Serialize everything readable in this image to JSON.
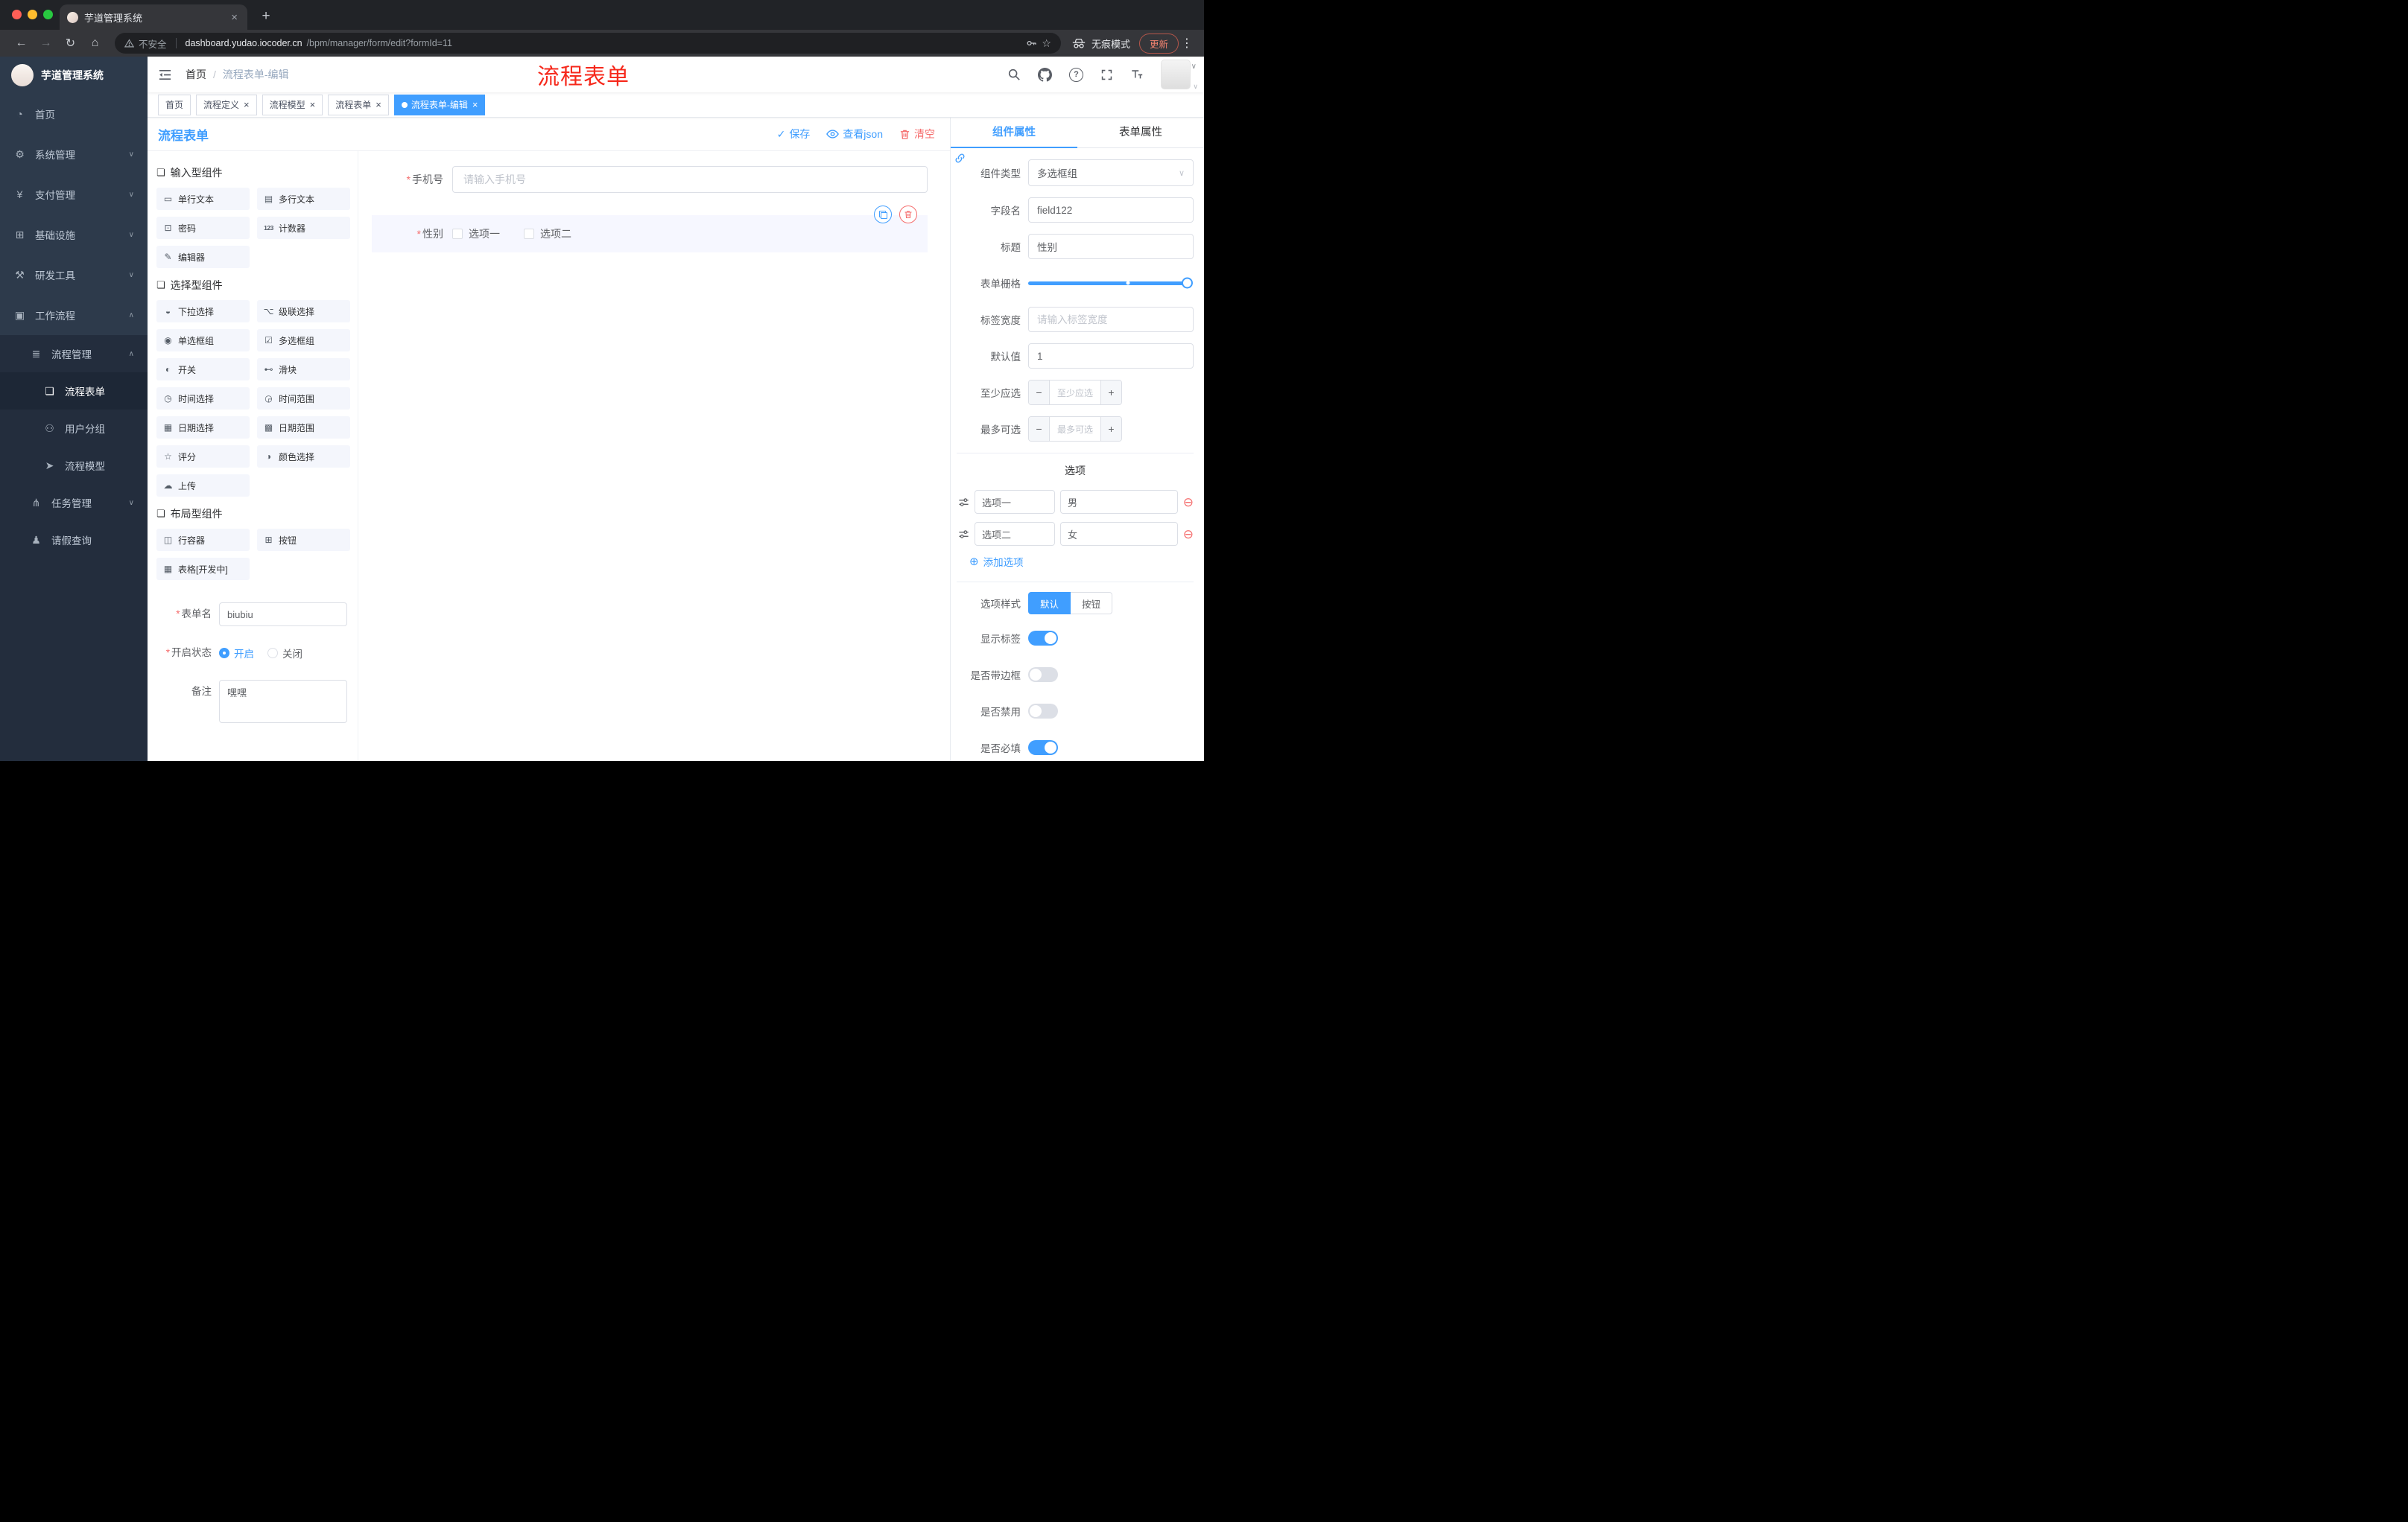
{
  "colors": {
    "accent": "#409EFF",
    "danger": "#F56C6C",
    "annotation_red": "#F6281B",
    "sidebar_bg": "#2D3A4B",
    "sidebar_sub_bg": "#232D3D",
    "active_tag_bg": "#409EFF"
  },
  "icons": {
    "close": "×",
    "chevron_down": "∨",
    "chevron_up": "∧",
    "back": "←",
    "forward": "→",
    "reload": "↻",
    "home": "⌂",
    "dots": "⋮",
    "star": "☆",
    "plus": "+",
    "minus": "−",
    "plus_circle": "⊕",
    "minus_circle": "⊖",
    "check": "✓",
    "question": "?"
  },
  "misc": {
    "required": "*"
  },
  "browser": {
    "tab": {
      "title": "芋道管理系统"
    },
    "address": {
      "security_label": "不安全",
      "host": "dashboard.yudao.iocoder.cn",
      "path": "/bpm/manager/form/edit?formId=11"
    },
    "incognito_label": "无痕模式",
    "update_label": "更新"
  },
  "annotation": {
    "text": "流程表单"
  },
  "sidebar": {
    "logo_title": "芋道管理系统",
    "items": [
      {
        "label": "首页",
        "glyph": "◔"
      },
      {
        "label": "系统管理",
        "glyph": "⚙",
        "chevron": "∨"
      },
      {
        "label": "支付管理",
        "glyph": "¥",
        "chevron": "∨"
      },
      {
        "label": "基础设施",
        "glyph": "⊞",
        "chevron": "∨"
      },
      {
        "label": "研发工具",
        "glyph": "⚒",
        "chevron": "∨"
      },
      {
        "label": "工作流程",
        "glyph": "▣",
        "chevron": "∧"
      },
      {
        "label": "流程管理",
        "glyph": "≣",
        "chevron": "∧"
      },
      {
        "label": "流程表单",
        "glyph": "❏"
      },
      {
        "label": "用户分组",
        "glyph": "⚇"
      },
      {
        "label": "流程模型",
        "glyph": "➤"
      },
      {
        "label": "任务管理",
        "glyph": "⋔",
        "chevron": "∨"
      },
      {
        "label": "请假查询",
        "glyph": "♟"
      }
    ]
  },
  "navbar": {
    "breadcrumb": {
      "home": "首页",
      "separator": "/",
      "current": "流程表单-编辑"
    }
  },
  "tags": [
    {
      "label": "首页"
    },
    {
      "label": "流程定义"
    },
    {
      "label": "流程模型"
    },
    {
      "label": "流程表单"
    },
    {
      "label": "流程表单-编辑"
    }
  ],
  "actionbar": {
    "title": "流程表单",
    "save": "保存",
    "view_json": "查看json",
    "clear": "清空"
  },
  "palette": {
    "groups": [
      {
        "title": "输入型组件",
        "items": [
          {
            "label": "单行文本",
            "glyph": "▭"
          },
          {
            "label": "多行文本",
            "glyph": "▤"
          },
          {
            "label": "密码",
            "glyph": "⊡"
          },
          {
            "label": "计数器",
            "glyph": "123"
          },
          {
            "label": "编辑器",
            "glyph": "✎"
          }
        ]
      },
      {
        "title": "选择型组件",
        "items": [
          {
            "label": "下拉选择",
            "glyph": "◒"
          },
          {
            "label": "级联选择",
            "glyph": "⌥"
          },
          {
            "label": "单选框组",
            "glyph": "◉"
          },
          {
            "label": "多选框组",
            "glyph": "☑"
          },
          {
            "label": "开关",
            "glyph": "◐"
          },
          {
            "label": "滑块",
            "glyph": "⊷"
          },
          {
            "label": "时间选择",
            "glyph": "◷"
          },
          {
            "label": "时间范围",
            "glyph": "◶"
          },
          {
            "label": "日期选择",
            "glyph": "▦"
          },
          {
            "label": "日期范围",
            "glyph": "▩"
          },
          {
            "label": "评分",
            "glyph": "☆"
          },
          {
            "label": "颜色选择",
            "glyph": "◑"
          },
          {
            "label": "上传",
            "glyph": "☁"
          }
        ]
      },
      {
        "title": "布局型组件",
        "items": [
          {
            "label": "行容器",
            "glyph": "◫"
          },
          {
            "label": "按钮",
            "glyph": "⊞"
          },
          {
            "label": "表格[开发中]",
            "glyph": "▦"
          }
        ]
      }
    ],
    "form": {
      "name_label": "表单名",
      "name_value": "biubiu",
      "status_label": "开启状态",
      "status_on": "开启",
      "status_off": "关闭",
      "remark_label": "备注",
      "remark_value": "嘿嘿"
    }
  },
  "canvas": {
    "phone": {
      "label": "手机号",
      "placeholder": "请输入手机号"
    },
    "gender": {
      "label": "性别",
      "option1": "选项一",
      "option2": "选项二"
    }
  },
  "props": {
    "tab_component": "组件属性",
    "tab_form": "表单属性",
    "component_type": {
      "label": "组件类型",
      "value": "多选框组"
    },
    "field_name": {
      "label": "字段名",
      "value": "field122"
    },
    "title": {
      "label": "标题",
      "value": "性别"
    },
    "grid": {
      "label": "表单栅格"
    },
    "label_width": {
      "label": "标签宽度",
      "placeholder": "请输入标签宽度"
    },
    "default_value": {
      "label": "默认值",
      "value": "1"
    },
    "min_select": {
      "label": "至少应选",
      "placeholder": "至少应选"
    },
    "max_select": {
      "label": "最多可选",
      "placeholder": "最多可选"
    },
    "options_title": "选项",
    "options": [
      {
        "label": "选项一",
        "value": "男"
      },
      {
        "label": "选项二",
        "value": "女"
      }
    ],
    "add_option": "添加选项",
    "style": {
      "label": "选项样式",
      "default": "默认",
      "button": "按钮"
    },
    "switches": [
      {
        "label": "显示标签",
        "on": true
      },
      {
        "label": "是否带边框",
        "on": false
      },
      {
        "label": "是否禁用",
        "on": false
      },
      {
        "label": "是否必填",
        "on": true
      }
    ]
  }
}
